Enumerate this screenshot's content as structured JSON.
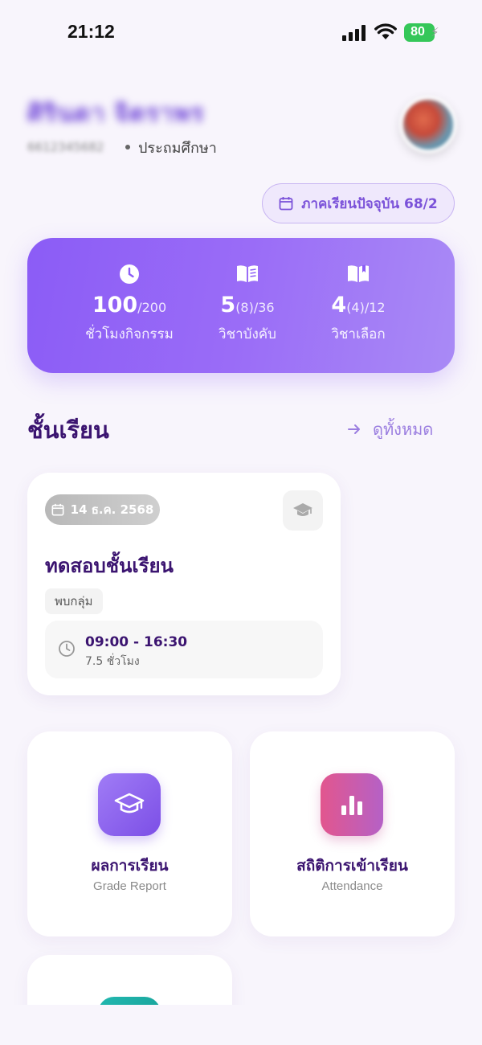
{
  "status_bar": {
    "time": "21:12",
    "battery": "80"
  },
  "profile": {
    "name": "ศิรินดา จิตราพร",
    "student_id": "6612345682",
    "level": "ประถมศึกษา"
  },
  "term_chip": {
    "label": "ภาคเรียนปัจจุบัน 68/2"
  },
  "stats": [
    {
      "value": "100",
      "total": "/200",
      "label": "ชั่วโมงกิจกรรม",
      "icon": "clock-icon"
    },
    {
      "value": "5",
      "total": "(8)/36",
      "label": "วิชาบังคับ",
      "icon": "book-icon"
    },
    {
      "value": "4",
      "total": "(4)/12",
      "label": "วิชาเลือก",
      "icon": "open-book-icon"
    }
  ],
  "section": {
    "title": "ชั้นเรียน",
    "see_all": "ดูทั้งหมด"
  },
  "class_card": {
    "date": "14 ธ.ค. 2568",
    "title": "ทดสอบชั้นเรียน",
    "type": "พบกลุ่ม",
    "time": "09:00 - 16:30",
    "duration": "7.5 ชั่วโมง"
  },
  "tiles": [
    {
      "name": "ผลการเรียน",
      "subtitle": "Grade Report",
      "icon": "graduation-cap-icon",
      "color": "#8b5cf6"
    },
    {
      "name": "สถิติการเข้าเรียน",
      "subtitle": "Attendance",
      "icon": "bar-chart-icon",
      "color": "#e2568e"
    }
  ]
}
